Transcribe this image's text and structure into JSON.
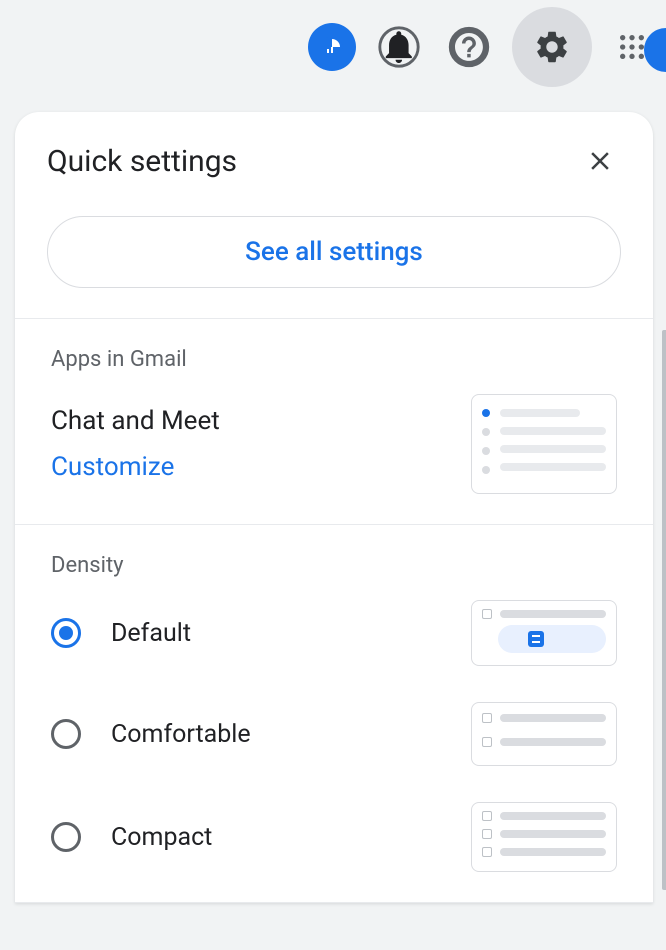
{
  "panel": {
    "title": "Quick settings",
    "see_all_label": "See all settings"
  },
  "apps_section": {
    "title": "Apps in Gmail",
    "name": "Chat and Meet",
    "customize_label": "Customize"
  },
  "density_section": {
    "title": "Density",
    "options": [
      {
        "label": "Default",
        "selected": true
      },
      {
        "label": "Comfortable",
        "selected": false
      },
      {
        "label": "Compact",
        "selected": false
      }
    ]
  }
}
